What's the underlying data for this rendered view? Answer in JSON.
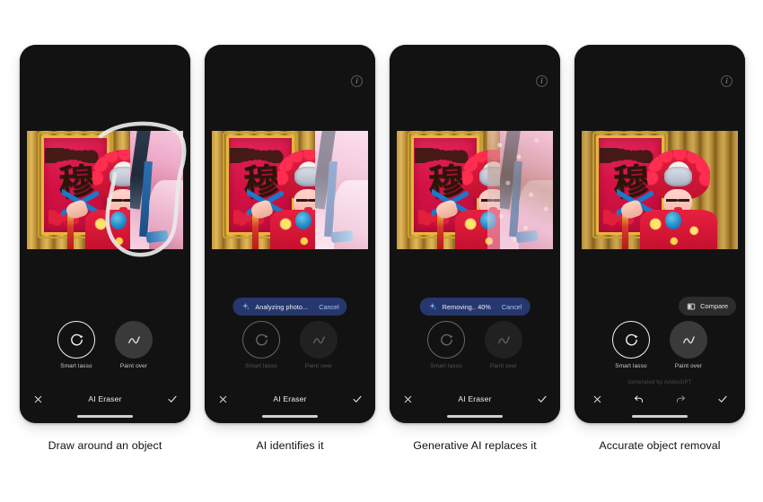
{
  "page": {
    "background": "#ffffff",
    "accent_pill": "#26376d",
    "accent_link": "#a9c4f5"
  },
  "app": {
    "title": "AI Eraser",
    "generated_by": "Generated by AndesGPT"
  },
  "icons": {
    "info": "i",
    "close": "close-icon",
    "confirm": "check-icon",
    "undo": "undo-icon",
    "redo": "redo-icon",
    "sparkle": "sparkle-icon",
    "compare": "compare-icon"
  },
  "photo": {
    "banner_glyph": "穆"
  },
  "tools": {
    "smart_lasso": "Smart lasso",
    "paint_over": "Paint over"
  },
  "panels": [
    {
      "id": "draw-around-object",
      "caption": "Draw around an object",
      "title": "AI Eraser",
      "status": null,
      "cancel": null,
      "compare": null,
      "generated_by": null,
      "has_info_icon": false,
      "footer_type": "title",
      "tools_dimmed": false,
      "overlay": "lasso"
    },
    {
      "id": "ai-identifies-it",
      "caption": "AI identifies it",
      "title": "AI Eraser",
      "status": "Analyzing photo...",
      "cancel": "Cancel",
      "compare": null,
      "generated_by": null,
      "has_info_icon": true,
      "footer_type": "title",
      "tools_dimmed": true,
      "overlay": "selection"
    },
    {
      "id": "generative-ai-replaces-it",
      "caption": "Generative AI replaces it",
      "title": "AI Eraser",
      "status": "Removing.. 40%",
      "cancel": "Cancel",
      "compare": null,
      "generated_by": null,
      "has_info_icon": true,
      "footer_type": "title",
      "tools_dimmed": true,
      "overlay": "dissolve"
    },
    {
      "id": "accurate-object-removal",
      "caption": "Accurate object removal",
      "title": "AI Eraser",
      "status": null,
      "cancel": null,
      "compare": "Compare",
      "generated_by": "Generated by AndesGPT",
      "has_info_icon": true,
      "footer_type": "undo-redo",
      "tools_dimmed": false,
      "overlay": "clean"
    }
  ]
}
